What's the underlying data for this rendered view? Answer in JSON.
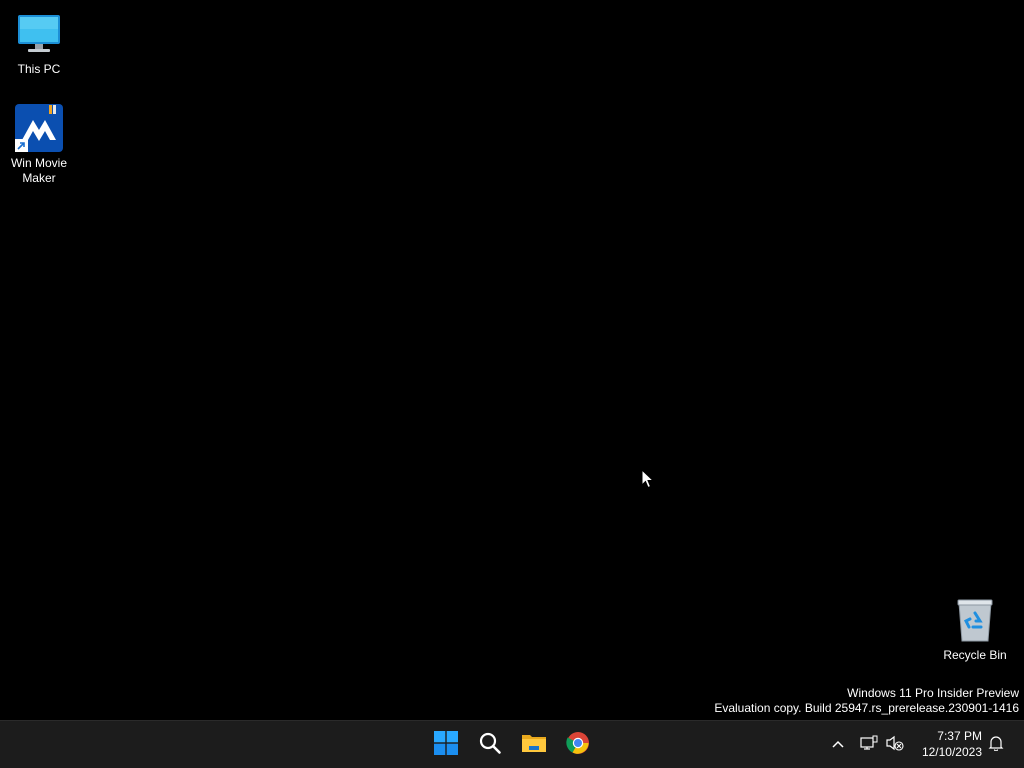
{
  "desktop": {
    "background_color": "#000000",
    "icons": [
      {
        "label": "This PC",
        "icon": "monitor-icon"
      },
      {
        "label": "Win Movie\nMaker",
        "icon": "win-movie-maker-icon"
      },
      {
        "label": "Recycle Bin",
        "icon": "recycle-bin-icon"
      }
    ]
  },
  "watermark": {
    "line1": "Windows 11 Pro Insider Preview",
    "line2": "Evaluation copy. Build 25947.rs_prerelease.230901-1416"
  },
  "taskbar": {
    "background_color": "#1c1c1c",
    "pinned": [
      {
        "name": "Start",
        "icon": "windows-logo-icon"
      },
      {
        "name": "Search",
        "icon": "search-icon"
      },
      {
        "name": "File Explorer",
        "icon": "folder-icon"
      },
      {
        "name": "Google Chrome",
        "icon": "chrome-icon"
      }
    ],
    "tray": {
      "icons": [
        "chevron-up-icon",
        "network-icon",
        "volume-muted-icon",
        "notification-bell-icon"
      ],
      "time": "7:37 PM",
      "date": "12/10/2023"
    }
  }
}
